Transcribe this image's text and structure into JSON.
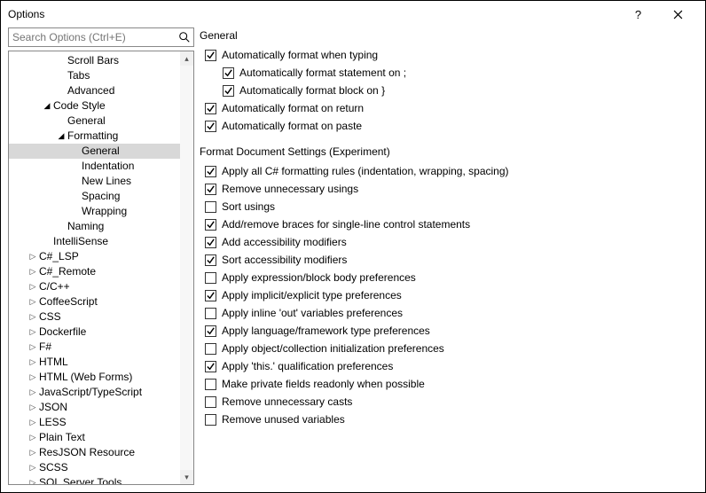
{
  "window": {
    "title": "Options"
  },
  "search": {
    "placeholder": "Search Options (Ctrl+E)"
  },
  "tree": [
    {
      "label": "Scroll Bars",
      "indent": 3,
      "exp": ""
    },
    {
      "label": "Tabs",
      "indent": 3,
      "exp": ""
    },
    {
      "label": "Advanced",
      "indent": 3,
      "exp": ""
    },
    {
      "label": "Code Style",
      "indent": 2,
      "exp": "down"
    },
    {
      "label": "General",
      "indent": 3,
      "exp": ""
    },
    {
      "label": "Formatting",
      "indent": 3,
      "exp": "down"
    },
    {
      "label": "General",
      "indent": 4,
      "exp": "",
      "selected": true
    },
    {
      "label": "Indentation",
      "indent": 4,
      "exp": ""
    },
    {
      "label": "New Lines",
      "indent": 4,
      "exp": ""
    },
    {
      "label": "Spacing",
      "indent": 4,
      "exp": ""
    },
    {
      "label": "Wrapping",
      "indent": 4,
      "exp": ""
    },
    {
      "label": "Naming",
      "indent": 3,
      "exp": ""
    },
    {
      "label": "IntelliSense",
      "indent": 2,
      "exp": ""
    },
    {
      "label": "C#_LSP",
      "indent": 1,
      "exp": "right"
    },
    {
      "label": "C#_Remote",
      "indent": 1,
      "exp": "right"
    },
    {
      "label": "C/C++",
      "indent": 1,
      "exp": "right"
    },
    {
      "label": "CoffeeScript",
      "indent": 1,
      "exp": "right"
    },
    {
      "label": "CSS",
      "indent": 1,
      "exp": "right"
    },
    {
      "label": "Dockerfile",
      "indent": 1,
      "exp": "right"
    },
    {
      "label": "F#",
      "indent": 1,
      "exp": "right"
    },
    {
      "label": "HTML",
      "indent": 1,
      "exp": "right"
    },
    {
      "label": "HTML (Web Forms)",
      "indent": 1,
      "exp": "right"
    },
    {
      "label": "JavaScript/TypeScript",
      "indent": 1,
      "exp": "right"
    },
    {
      "label": "JSON",
      "indent": 1,
      "exp": "right"
    },
    {
      "label": "LESS",
      "indent": 1,
      "exp": "right"
    },
    {
      "label": "Plain Text",
      "indent": 1,
      "exp": "right"
    },
    {
      "label": "ResJSON Resource",
      "indent": 1,
      "exp": "right"
    },
    {
      "label": "SCSS",
      "indent": 1,
      "exp": "right"
    },
    {
      "label": "SQL Server Tools",
      "indent": 1,
      "exp": "right"
    }
  ],
  "general": {
    "title": "General",
    "items": [
      {
        "label": "Automatically format when typing",
        "checked": true,
        "indent": 0
      },
      {
        "label": "Automatically format statement on ;",
        "checked": true,
        "indent": 1
      },
      {
        "label": "Automatically format block on }",
        "checked": true,
        "indent": 1
      },
      {
        "label": "Automatically format on return",
        "checked": true,
        "indent": 0
      },
      {
        "label": "Automatically format on paste",
        "checked": true,
        "indent": 0
      }
    ]
  },
  "formatDoc": {
    "title": "Format Document Settings (Experiment)",
    "items": [
      {
        "label": "Apply all C# formatting rules (indentation, wrapping, spacing)",
        "checked": true
      },
      {
        "label": "Remove unnecessary usings",
        "checked": true
      },
      {
        "label": "Sort usings",
        "checked": false
      },
      {
        "label": "Add/remove braces for single-line control statements",
        "checked": true
      },
      {
        "label": "Add accessibility modifiers",
        "checked": true
      },
      {
        "label": "Sort accessibility modifiers",
        "checked": true
      },
      {
        "label": "Apply expression/block body preferences",
        "checked": false
      },
      {
        "label": "Apply implicit/explicit type preferences",
        "checked": true
      },
      {
        "label": "Apply inline 'out' variables preferences",
        "checked": false
      },
      {
        "label": "Apply language/framework type preferences",
        "checked": true
      },
      {
        "label": "Apply object/collection initialization preferences",
        "checked": false
      },
      {
        "label": "Apply 'this.' qualification preferences",
        "checked": true
      },
      {
        "label": "Make private fields readonly when possible",
        "checked": false
      },
      {
        "label": "Remove unnecessary casts",
        "checked": false
      },
      {
        "label": "Remove unused variables",
        "checked": false
      }
    ]
  }
}
